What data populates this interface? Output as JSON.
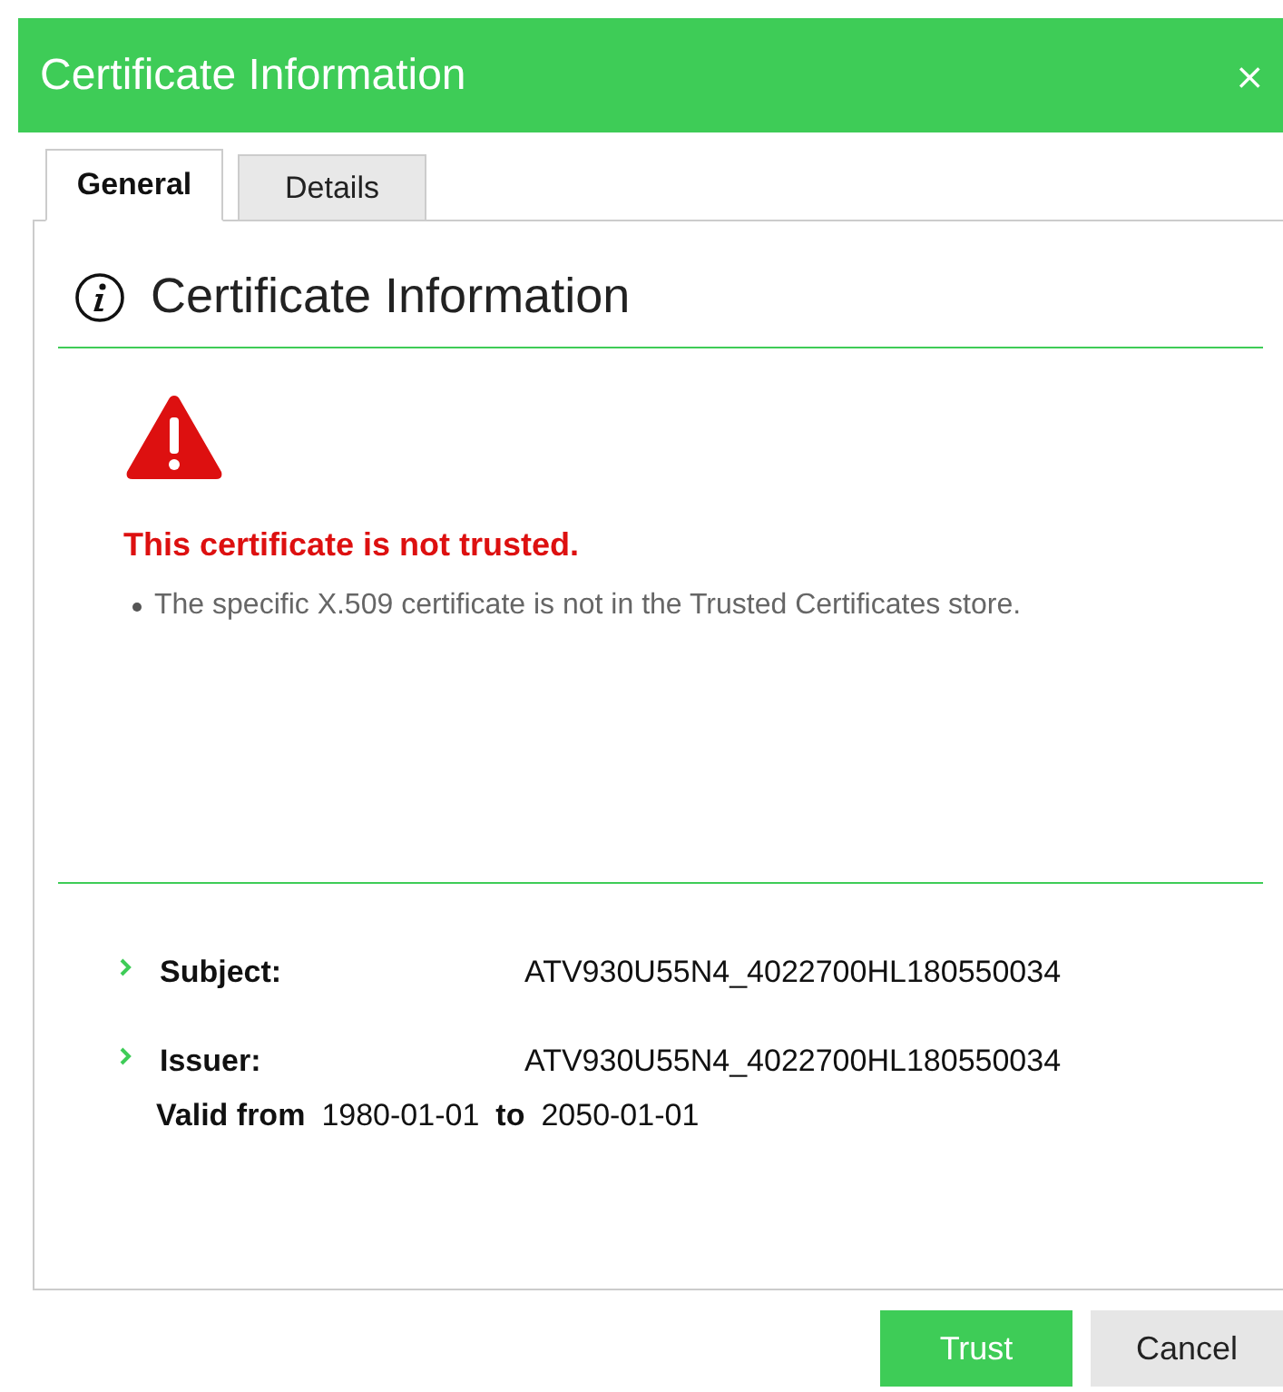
{
  "window": {
    "title": "Certificate Information",
    "close": "×"
  },
  "tabs": [
    {
      "label": "General",
      "selected": true
    },
    {
      "label": "Details",
      "selected": false
    }
  ],
  "heading": "Certificate Information",
  "warning": {
    "title": "This certificate is not trusted.",
    "reasons": [
      "The specific X.509 certificate is not in the Trusted Certificates store."
    ]
  },
  "fields": [
    {
      "label": "Subject:",
      "value": "ATV930U55N4_4022700HL180550034",
      "expanded": false
    },
    {
      "label": "Issuer:",
      "value": "ATV930U55N4_4022700HL180550034",
      "expanded": false
    }
  ],
  "validity": {
    "from_label": "Valid from",
    "from": "1980-01-01",
    "to_label": "to",
    "to": "2050-01-01"
  },
  "buttons": [
    {
      "label": "Trust",
      "kind": "primary"
    },
    {
      "label": "Cancel",
      "kind": "secondary"
    }
  ]
}
